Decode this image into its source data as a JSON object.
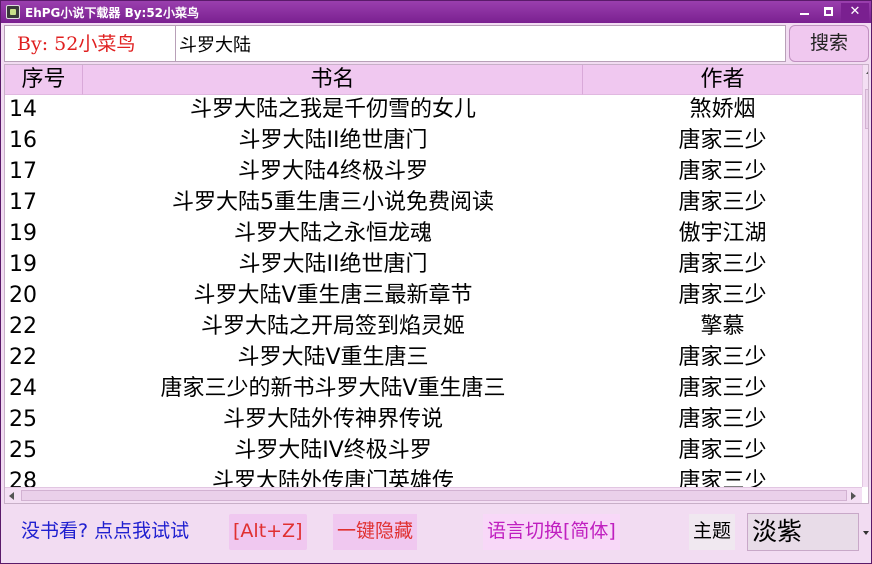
{
  "window": {
    "title": "EhPG小说下载器    By:52小菜鸟"
  },
  "search": {
    "by_label": "By: 52小菜鸟",
    "query": "斗罗大陆",
    "button_label": "搜索"
  },
  "grid": {
    "columns": [
      "序号",
      "书名",
      "作者"
    ],
    "rows": [
      {
        "id": "14",
        "title": "斗罗大陆之我是千仞雪的女儿",
        "author": "煞娇烟"
      },
      {
        "id": "16",
        "title": "斗罗大陆II绝世唐门",
        "author": "唐家三少"
      },
      {
        "id": "17",
        "title": "斗罗大陆4终极斗罗",
        "author": "唐家三少"
      },
      {
        "id": "17",
        "title": "斗罗大陆5重生唐三小说免费阅读",
        "author": "唐家三少"
      },
      {
        "id": "19",
        "title": "斗罗大陆之永恒龙魂",
        "author": "傲宇江湖"
      },
      {
        "id": "19",
        "title": "斗罗大陆II绝世唐门",
        "author": "唐家三少"
      },
      {
        "id": "20",
        "title": "斗罗大陆V重生唐三最新章节",
        "author": "唐家三少"
      },
      {
        "id": "22",
        "title": "斗罗大陆之开局签到焰灵姬",
        "author": "擎慕"
      },
      {
        "id": "22",
        "title": "斗罗大陆V重生唐三",
        "author": "唐家三少"
      },
      {
        "id": "24",
        "title": "唐家三少的新书斗罗大陆V重生唐三",
        "author": "唐家三少"
      },
      {
        "id": "25",
        "title": "斗罗大陆外传神界传说",
        "author": "唐家三少"
      },
      {
        "id": "25",
        "title": "斗罗大陆IV终极斗罗",
        "author": "唐家三少"
      },
      {
        "id": "28",
        "title": "斗罗大陆外传唐门英雄传",
        "author": "唐家三少"
      }
    ]
  },
  "bottom": {
    "no_book_link": "没书看? 点点我试试",
    "hotkey": "[Alt+Z]",
    "hide_button": "一键隐藏",
    "language_button": "语言切换[简体]",
    "theme_label": "主题",
    "theme_value": "淡紫"
  },
  "colors": {
    "title_bar": "#8a2fa0",
    "header_bg": "#f0c8f0",
    "window_bg": "#f2dcf2",
    "accent_red": "#e02020",
    "link_blue": "#2020d0",
    "accent_magenta": "#c020c0"
  }
}
